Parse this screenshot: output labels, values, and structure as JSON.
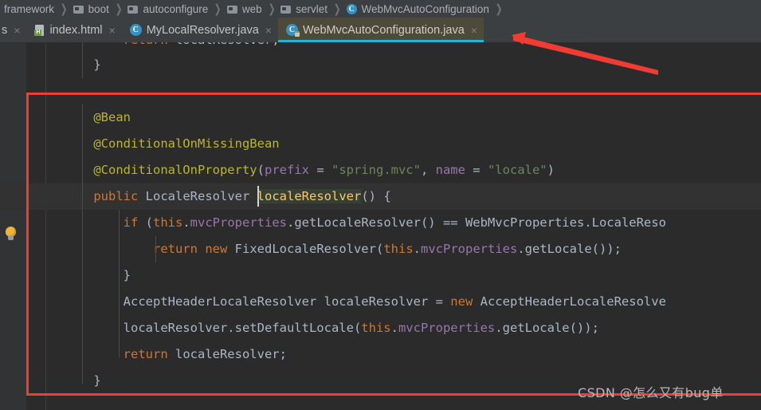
{
  "window": {
    "app": "IntelliJ IDEA",
    "accent_active_tab_underline": "#29b2d4",
    "annotation_red": "#f03c32",
    "editor_bg": "#2b2b2b",
    "gutter_bg": "#313335"
  },
  "breadcrumb": {
    "items": [
      {
        "label": "framework",
        "icon": "folder-icon",
        "truncated": true
      },
      {
        "label": "boot",
        "icon": "folder-icon"
      },
      {
        "label": "autoconfigure",
        "icon": "folder-icon"
      },
      {
        "label": "web",
        "icon": "folder-icon"
      },
      {
        "label": "servlet",
        "icon": "folder-icon"
      },
      {
        "label": "WebMvcAutoConfiguration",
        "icon": "java-class-icon"
      }
    ],
    "separator": "❯",
    "class_icon_letter": "C"
  },
  "tabs": {
    "close_glyph": "×",
    "items": [
      {
        "label": "s",
        "icon": "partial-tab-icon",
        "active": false,
        "partial": true
      },
      {
        "label": "index.html",
        "icon": "html-file-icon",
        "active": false
      },
      {
        "label": "MyLocalResolver.java",
        "icon": "java-class-icon",
        "active": false
      },
      {
        "label": "WebMvcAutoConfiguration.java",
        "icon": "java-class-locked-icon",
        "active": true
      }
    ]
  },
  "gutter": {
    "intention_icon": "lightbulb-icon"
  },
  "code": {
    "language": "java",
    "lines": [
      {
        "id": "line-clipped-top",
        "clipped": true,
        "tokens": [
          {
            "t": "        ",
            "c": "punc"
          },
          {
            "t": "return",
            "c": "kw"
          },
          {
            "t": " ",
            "c": "punc"
          },
          {
            "t": "localResolver",
            "c": "id"
          },
          {
            "t": ";",
            "c": "punc"
          }
        ]
      },
      {
        "id": "line-close-brace-prev",
        "tokens": [
          {
            "t": "    }",
            "c": "brace"
          }
        ]
      },
      {
        "id": "line-blank-1",
        "tokens": [
          {
            "t": "",
            "c": "punc"
          }
        ]
      },
      {
        "id": "line-bean-annotation",
        "tokens": [
          {
            "t": "    @Bean",
            "c": "anno"
          }
        ]
      },
      {
        "id": "line-conditional-on-missing-bean",
        "tokens": [
          {
            "t": "    @ConditionalOnMissingBean",
            "c": "anno"
          }
        ]
      },
      {
        "id": "line-conditional-on-property",
        "tokens": [
          {
            "t": "    @ConditionalOnProperty",
            "c": "anno"
          },
          {
            "t": "(",
            "c": "punc"
          },
          {
            "t": "prefix",
            "c": "fld"
          },
          {
            "t": " = ",
            "c": "punc"
          },
          {
            "t": "\"spring.mvc\"",
            "c": "str"
          },
          {
            "t": ", ",
            "c": "punc"
          },
          {
            "t": "name",
            "c": "fld"
          },
          {
            "t": " = ",
            "c": "punc"
          },
          {
            "t": "\"locale\"",
            "c": "str"
          },
          {
            "t": ")",
            "c": "punc"
          }
        ]
      },
      {
        "id": "line-method-signature",
        "highlighted": true,
        "tokens": [
          {
            "t": "    ",
            "c": "punc"
          },
          {
            "t": "public",
            "c": "kw"
          },
          {
            "t": " ",
            "c": "punc"
          },
          {
            "t": "LocaleResolver",
            "c": "typ"
          },
          {
            "t": " ",
            "c": "punc"
          },
          {
            "t": "localeResolver",
            "c": "caret-sel"
          },
          {
            "t": "() {",
            "c": "punc"
          }
        ]
      },
      {
        "id": "line-if-condition",
        "tokens": [
          {
            "t": "        ",
            "c": "punc"
          },
          {
            "t": "if",
            "c": "kw"
          },
          {
            "t": " (",
            "c": "punc"
          },
          {
            "t": "this",
            "c": "kw"
          },
          {
            "t": ".",
            "c": "punc"
          },
          {
            "t": "mvcProperties",
            "c": "fld"
          },
          {
            "t": ".getLocaleResolver() == ",
            "c": "punc"
          },
          {
            "t": "WebMvcProperties",
            "c": "typ"
          },
          {
            "t": ".LocaleReso",
            "c": "punc"
          }
        ]
      },
      {
        "id": "line-return-fixed-resolver",
        "tokens": [
          {
            "t": "            ",
            "c": "punc"
          },
          {
            "t": "return",
            "c": "kw"
          },
          {
            "t": " ",
            "c": "punc"
          },
          {
            "t": "new",
            "c": "kw"
          },
          {
            "t": " ",
            "c": "punc"
          },
          {
            "t": "FixedLocaleResolver",
            "c": "typ"
          },
          {
            "t": "(",
            "c": "punc"
          },
          {
            "t": "this",
            "c": "kw"
          },
          {
            "t": ".",
            "c": "punc"
          },
          {
            "t": "mvcProperties",
            "c": "fld"
          },
          {
            "t": ".getLocale());",
            "c": "punc"
          }
        ]
      },
      {
        "id": "line-if-close-brace",
        "tokens": [
          {
            "t": "        }",
            "c": "brace"
          }
        ]
      },
      {
        "id": "line-accept-header-decl",
        "tokens": [
          {
            "t": "        ",
            "c": "punc"
          },
          {
            "t": "AcceptHeaderLocaleResolver",
            "c": "typ"
          },
          {
            "t": " localeResolver = ",
            "c": "punc"
          },
          {
            "t": "new",
            "c": "kw"
          },
          {
            "t": " ",
            "c": "punc"
          },
          {
            "t": "AcceptHeaderLocaleResolve",
            "c": "typ"
          }
        ]
      },
      {
        "id": "line-set-default-locale",
        "tokens": [
          {
            "t": "        localeResolver.setDefaultLocale(",
            "c": "punc"
          },
          {
            "t": "this",
            "c": "kw"
          },
          {
            "t": ".",
            "c": "punc"
          },
          {
            "t": "mvcProperties",
            "c": "fld"
          },
          {
            "t": ".getLocale());",
            "c": "punc"
          }
        ]
      },
      {
        "id": "line-return-locale-resolver",
        "tokens": [
          {
            "t": "        ",
            "c": "punc"
          },
          {
            "t": "return",
            "c": "kw"
          },
          {
            "t": " localeResolver;",
            "c": "punc"
          }
        ]
      },
      {
        "id": "line-method-close-brace",
        "tokens": [
          {
            "t": "    }",
            "c": "brace"
          }
        ]
      }
    ]
  },
  "annotations": {
    "watermark": "CSDN @怎么又有bug单",
    "red_rectangle": {
      "present": true
    },
    "red_arrow": {
      "present": true,
      "points_to": "tab-webmvcautoconfiguration"
    }
  }
}
